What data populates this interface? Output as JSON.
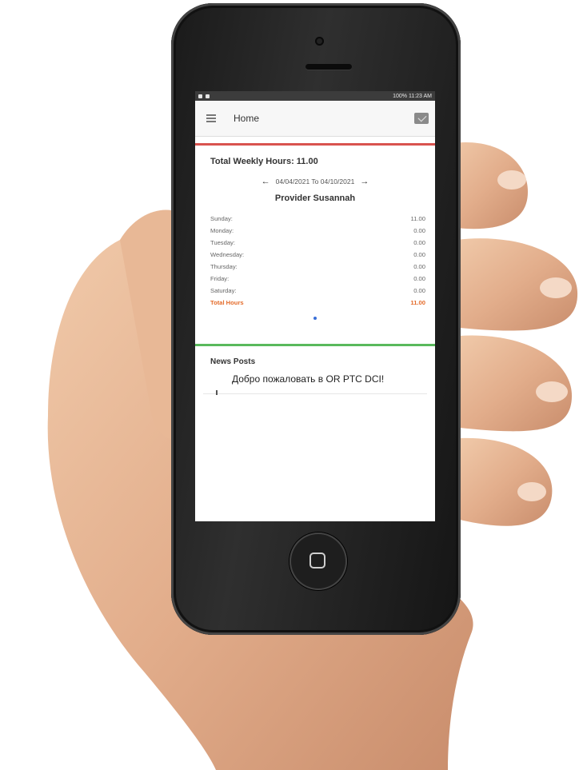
{
  "status_bar": {
    "right_text": "100% 11:23 AM"
  },
  "app_bar": {
    "title": "Home",
    "menu_icon": "hamburger-menu-icon",
    "mail_icon": "envelope-icon"
  },
  "weekly_hours": {
    "title": "Total Weekly Hours: 11.00",
    "date_range": "04/04/2021 To 04/10/2021",
    "prev_arrow": "←",
    "next_arrow": "→",
    "provider": "Provider Susannah",
    "days": [
      {
        "label": "Sunday:",
        "value": "11.00"
      },
      {
        "label": "Monday:",
        "value": "0.00"
      },
      {
        "label": "Tuesday:",
        "value": "0.00"
      },
      {
        "label": "Wednesday:",
        "value": "0.00"
      },
      {
        "label": "Thursday:",
        "value": "0.00"
      },
      {
        "label": "Friday:",
        "value": "0.00"
      },
      {
        "label": "Saturday:",
        "value": "0.00"
      }
    ],
    "total_label": "Total Hours",
    "total_value": "11.00",
    "accent_color": "#d9534f",
    "total_color": "#e46b2a"
  },
  "news": {
    "title": "News Posts",
    "item_text": "Добро пожаловать в OR PTC DCI!",
    "accent_color": "#59b95c"
  }
}
